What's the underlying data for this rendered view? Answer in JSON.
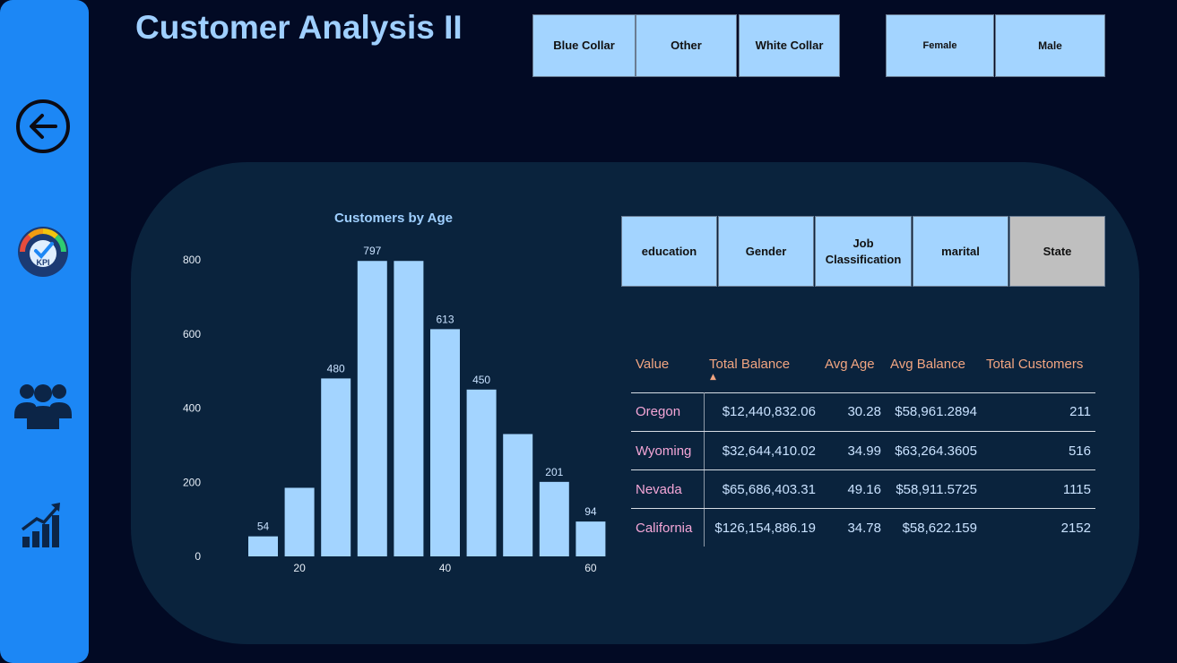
{
  "page": {
    "title": "Customer Analysis II"
  },
  "sidebar": {
    "items": [
      {
        "icon": "back-arrow-icon"
      },
      {
        "icon": "kpi-gauge-icon"
      },
      {
        "icon": "customers-group-icon"
      },
      {
        "icon": "growth-chart-icon"
      }
    ]
  },
  "job_slicer": {
    "options": [
      "Blue Collar",
      "Other",
      "White Collar"
    ]
  },
  "gender_slicer": {
    "options": [
      "Female",
      "Male"
    ]
  },
  "field_selector": {
    "options": [
      "education",
      "Gender",
      "Job Classification",
      "marital",
      "State"
    ],
    "selected": "State"
  },
  "chart_data": {
    "type": "bar",
    "title": "Customers by Age",
    "x": [
      15,
      20,
      25,
      30,
      35,
      40,
      45,
      50,
      55,
      60
    ],
    "values": [
      54,
      185,
      480,
      797,
      797,
      613,
      450,
      330,
      201,
      94
    ],
    "data_labels": [
      "54",
      "",
      "480",
      "797",
      "",
      "613",
      "450",
      "",
      "201",
      "94"
    ],
    "xticks": [
      20,
      40,
      60
    ],
    "yticks": [
      0,
      200,
      400,
      600,
      800
    ],
    "ylim": [
      0,
      800
    ],
    "xlabel": "",
    "ylabel": "",
    "bar_color": "#a3d4ff"
  },
  "table": {
    "columns": [
      "Value",
      "Total Balance",
      "Avg Age",
      "Avg Balance",
      "Total Customers"
    ],
    "sort_indicator": "▲",
    "rows": [
      {
        "state": "Oregon",
        "total_balance": "$12,440,832.06",
        "avg_age": "30.28",
        "avg_balance": "$58,961.2894",
        "total_customers": "211"
      },
      {
        "state": "Wyoming",
        "total_balance": "$32,644,410.02",
        "avg_age": "34.99",
        "avg_balance": "$63,264.3605",
        "total_customers": "516"
      },
      {
        "state": "Nevada",
        "total_balance": "$65,686,403.31",
        "avg_age": "49.16",
        "avg_balance": "$58,911.5725",
        "total_customers": "1115"
      },
      {
        "state": "California",
        "total_balance": "$126,154,886.19",
        "avg_age": "34.78",
        "avg_balance": "$58,622.159",
        "total_customers": "2152"
      }
    ]
  },
  "colors": {
    "background": "#020a24",
    "sidebar": "#1c87f5",
    "panel": "#0a233d",
    "title": "#9fcfff",
    "header": "#f1a581",
    "state_text": "#f4a6d7",
    "slicer": "#a3d4ff",
    "selected": "#bfbfbf"
  }
}
